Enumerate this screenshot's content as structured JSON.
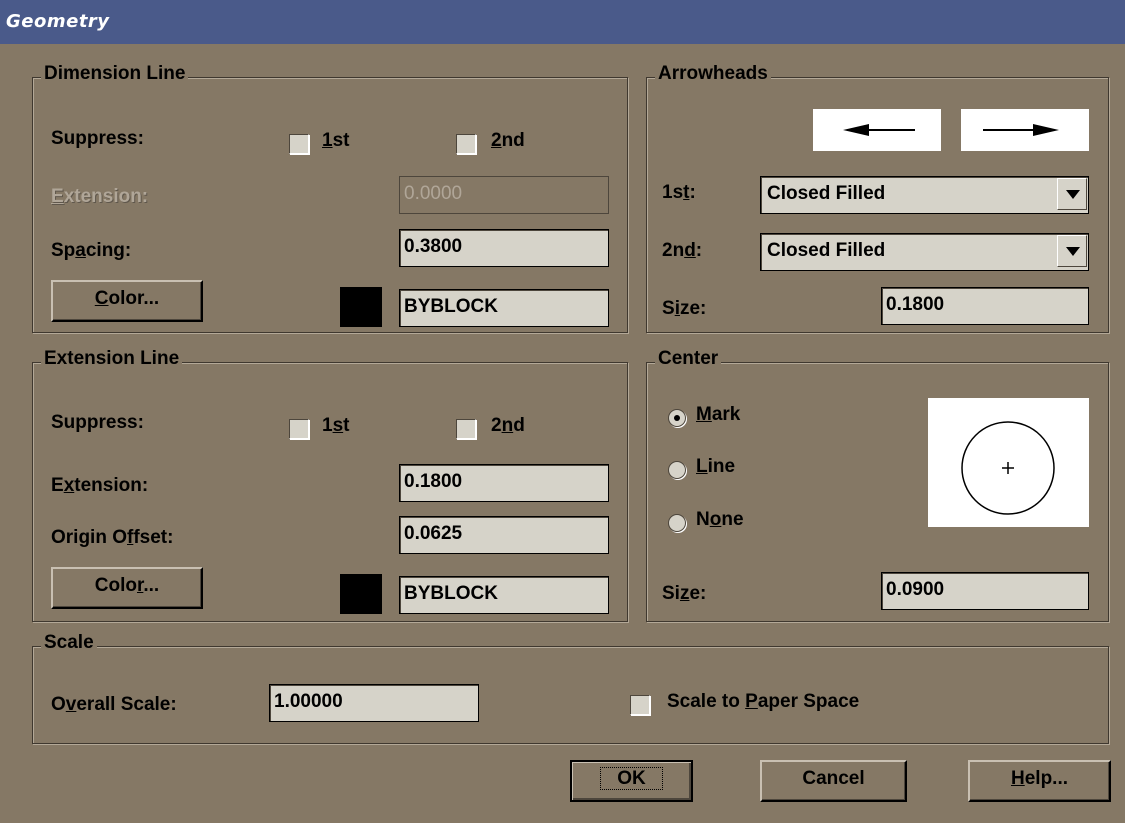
{
  "window": {
    "title": "Geometry"
  },
  "dimension_line": {
    "title": "Dimension Line",
    "suppress_label": "Suppress:",
    "suppress_1st": {
      "prefix": "",
      "key": "1",
      "suffix": "st",
      "checked": false
    },
    "suppress_2nd": {
      "prefix": "",
      "key": "2",
      "suffix": "nd",
      "checked": false
    },
    "extension_label": {
      "prefix": "",
      "key": "E",
      "suffix": "xtension:"
    },
    "extension_value": "0.0000",
    "spacing_label": {
      "prefix": "Sp",
      "key": "a",
      "suffix": "cing:"
    },
    "spacing_value": "0.3800",
    "color_button": {
      "prefix": "",
      "key": "C",
      "suffix": "olor..."
    },
    "color_value": "BYBLOCK",
    "color_swatch": "#000000"
  },
  "arrowheads": {
    "title": "Arrowheads",
    "first_label": {
      "prefix": "1s",
      "key": "t",
      "suffix": ":"
    },
    "first_value": "Closed Filled",
    "second_label": {
      "prefix": "2n",
      "key": "d",
      "suffix": ":"
    },
    "second_value": "Closed Filled",
    "size_label": {
      "prefix": "S",
      "key": "i",
      "suffix": "ze:"
    },
    "size_value": "0.1800"
  },
  "extension_line": {
    "title": "Extension Line",
    "suppress_label": "Suppress:",
    "suppress_1st": {
      "prefix": "1",
      "key": "s",
      "suffix": "t",
      "checked": false
    },
    "suppress_2nd": {
      "prefix": "2",
      "key": "n",
      "suffix": "d",
      "checked": false
    },
    "extension_label": {
      "prefix": "E",
      "key": "x",
      "suffix": "tension:"
    },
    "extension_value": "0.1800",
    "origin_offset_label": {
      "prefix": "Origin O",
      "key": "f",
      "suffix": "fset:"
    },
    "origin_offset_value": "0.0625",
    "color_button": {
      "prefix": "Colo",
      "key": "r",
      "suffix": "..."
    },
    "color_value": "BYBLOCK",
    "color_swatch": "#000000"
  },
  "center": {
    "title": "Center",
    "options": [
      {
        "prefix": "",
        "key": "M",
        "suffix": "ark",
        "selected": true
      },
      {
        "prefix": "",
        "key": "L",
        "suffix": "ine",
        "selected": false
      },
      {
        "prefix": "N",
        "key": "o",
        "suffix": "ne",
        "selected": false
      }
    ],
    "size_label": {
      "prefix": "Si",
      "key": "z",
      "suffix": "e:"
    },
    "size_value": "0.0900"
  },
  "scale": {
    "title": "Scale",
    "overall_label": {
      "prefix": "O",
      "key": "v",
      "suffix": "erall Scale:"
    },
    "overall_value": "1.00000",
    "paper_space": {
      "prefix": "Scale to ",
      "key": "P",
      "suffix": "aper Space",
      "checked": false
    }
  },
  "buttons": {
    "ok": "OK",
    "cancel": "Cancel",
    "help": {
      "prefix": "",
      "key": "H",
      "suffix": "elp..."
    }
  }
}
